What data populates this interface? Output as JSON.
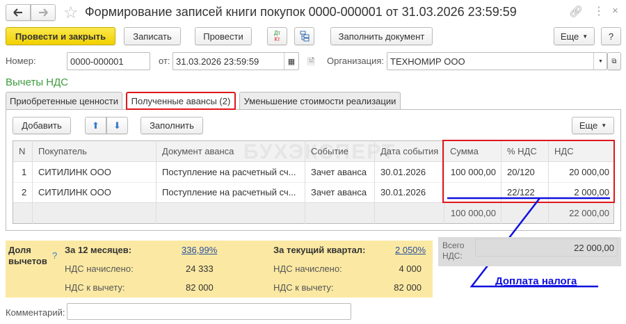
{
  "window": {
    "title": "Формирование записей книги покупок 0000-000001 от 31.03.2026 23:59:59"
  },
  "toolbar": {
    "post_close": "Провести и закрыть",
    "save": "Записать",
    "post": "Провести",
    "dt": "Дт",
    "kt": "Кт",
    "fill_doc": "Заполнить документ",
    "more": "Еще",
    "help": "?"
  },
  "fields": {
    "number_label": "Номер:",
    "number": "0000-000001",
    "date_label": "от:",
    "date": "31.03.2026 23:59:59",
    "org_label": "Организация:",
    "org": "ТЕХНОМИР ООО"
  },
  "section_title": "Вычеты НДС",
  "tabs": [
    "Приобретенные ценности",
    "Полученные авансы (2)",
    "Уменьшение стоимости реализации"
  ],
  "table_toolbar": {
    "add": "Добавить",
    "fill": "Заполнить",
    "more": "Еще"
  },
  "table": {
    "headers": [
      "N",
      "Покупатель",
      "Документ аванса",
      "Событие",
      "Дата события",
      "Сумма",
      "% НДС",
      "НДС"
    ],
    "rows": [
      [
        "1",
        "СИТИЛИНК ООО",
        "Поступление на расчетный сч...",
        "Зачет аванса",
        "30.01.2026",
        "100 000,00",
        "20/120",
        "20 000,00"
      ],
      [
        "2",
        "СИТИЛИНК ООО",
        "Поступление на расчетный сч...",
        "Зачет аванса",
        "30.01.2026",
        "",
        "22/122",
        "2 000,00"
      ]
    ],
    "totals": {
      "sum": "100 000,00",
      "vat": "22 000,00"
    }
  },
  "watermark": "БУХЭКСПЕРТ",
  "share": {
    "label1": "Доля",
    "label2": "вычетов",
    "help": "?",
    "m12_label": "За 12 месяцев:",
    "m12_value": "336,99%",
    "q_label": "За текущий квартал:",
    "q_value": "2 050%",
    "charged_label": "НДС начислено:",
    "deduct_label": "НДС к вычету:",
    "m12_charged": "24 333",
    "m12_deduct": "82 000",
    "q_charged": "4 000",
    "q_deduct": "82 000"
  },
  "total_vat": {
    "label1": "Всего",
    "label2": "НДС:",
    "value": "22 000,00"
  },
  "annotation": "Доплата налога",
  "comment": {
    "label": "Комментарий:",
    "value": ""
  }
}
